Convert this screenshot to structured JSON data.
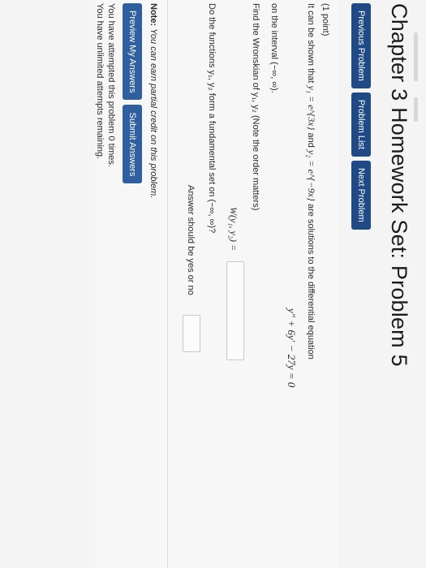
{
  "page": {
    "title": "Chapter 3 Homework Set: Problem 5"
  },
  "nav": {
    "previous": "Previous Problem",
    "list": "Problem List",
    "next": "Next Problem"
  },
  "problem": {
    "points": "(1 point)",
    "statement_prefix": "It can be shown that",
    "y1": "y₁ = e^{3x}",
    "and": "and",
    "y2": "y₂ = e^{−9x}",
    "statement_suffix": "are solutions to the differential equation",
    "equation": "y″ + 6y′ − 27y = 0",
    "interval_text": "on the interval (−∞, ∞).",
    "wronskian_prompt": "Find the Wronskian of y₁, y₂ (Note the order matters)",
    "wronskian_label": "W(y₁, y₂) =",
    "fundamental_prompt": "Do the functions y₁, y₂ form a fundamental set on (−∞, ∞)?",
    "yesno_prompt": "Answer should be yes or no"
  },
  "footer": {
    "note_label": "Note:",
    "note_text": "You can earn partial credit on this problem.",
    "preview_button": "Preview My Answers",
    "submit_button": "Submit Answers",
    "attempted": "You have attempted this problem 0 times.",
    "remaining": "You have unlimited attempts remaining."
  },
  "colors": {
    "button_bg": "#1f4a86",
    "page_bg": "#f4f4f4"
  }
}
